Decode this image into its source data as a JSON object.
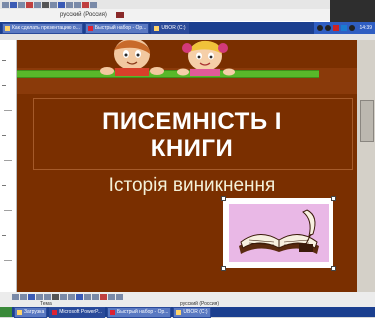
{
  "top": {
    "language": "русский (Россия)",
    "tasks": [
      {
        "label": "Как сделать презентацию о...",
        "active": false
      },
      {
        "label": "Быстрый набор - Op...",
        "active": false
      },
      {
        "label": "UBOR (C:)",
        "active": true
      }
    ],
    "clock": "14:39"
  },
  "slide": {
    "title_line1": "ПИСЕМНІСТЬ І",
    "title_line2": "КНИГИ",
    "subtitle": "Історія виникнення"
  },
  "bottom": {
    "status_left": "Тема",
    "status_language": "русский (Россия)",
    "tasks": [
      {
        "label": "Загрузка",
        "active": false
      },
      {
        "label": "Microsoft PowerP...",
        "active": true
      },
      {
        "label": "Быстрый набор - Op...",
        "active": false
      },
      {
        "label": "UBOR (C:)",
        "active": false
      }
    ]
  },
  "colors": {
    "slide_bg": "#7a2f00",
    "green_bar": "#58b82a",
    "title_text": "#ffffff",
    "subtitle_text": "#f4f0d8",
    "taskbar": "#1b3f8f"
  }
}
